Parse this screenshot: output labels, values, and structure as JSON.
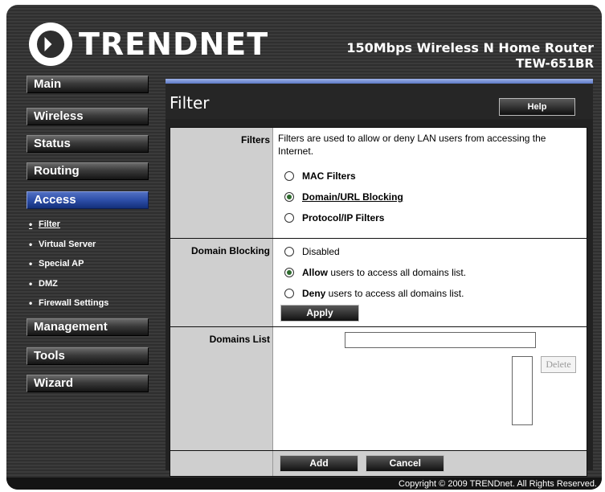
{
  "header": {
    "brand": "TRENDNET",
    "product_name": "150Mbps Wireless N Home Router",
    "model": "TEW-651BR"
  },
  "nav": {
    "main": "Main",
    "wireless": "Wireless",
    "status": "Status",
    "routing": "Routing",
    "access": "Access",
    "management": "Management",
    "tools": "Tools",
    "wizard": "Wizard",
    "submenu": [
      {
        "label": "Filter",
        "active": true
      },
      {
        "label": "Virtual Server"
      },
      {
        "label": "Special AP"
      },
      {
        "label": "DMZ"
      },
      {
        "label": "Firewall Settings"
      }
    ],
    "bullet": "•"
  },
  "content": {
    "title": "Filter",
    "help_label": "Help",
    "filters": {
      "label": "Filters",
      "description": "Filters are used to allow or deny LAN users from accessing the Internet.",
      "options": [
        {
          "label": "MAC Filters",
          "checked": false
        },
        {
          "label": "Domain/URL Blocking",
          "checked": true
        },
        {
          "label": "Protocol/IP Filters",
          "checked": false
        }
      ]
    },
    "domain_blocking": {
      "label": "Domain Blocking",
      "disabled": "Disabled",
      "allow_word": "Allow",
      "allow_rest": " users to access all domains list.",
      "deny_word": "Deny",
      "deny_rest": " users to access all domains list.",
      "apply_label": "Apply",
      "selected": "allow"
    },
    "domains_list": {
      "label": "Domains List",
      "input_value": "",
      "delete_label": "Delete"
    },
    "add_label": "Add",
    "cancel_label": "Cancel"
  },
  "footer": {
    "copyright": "Copyright © 2009 TRENDnet. All Rights Reserved."
  },
  "colors": {
    "active_nav": "#2d4ea8",
    "label_bg": "#cfcfcf",
    "background": "#333333"
  }
}
